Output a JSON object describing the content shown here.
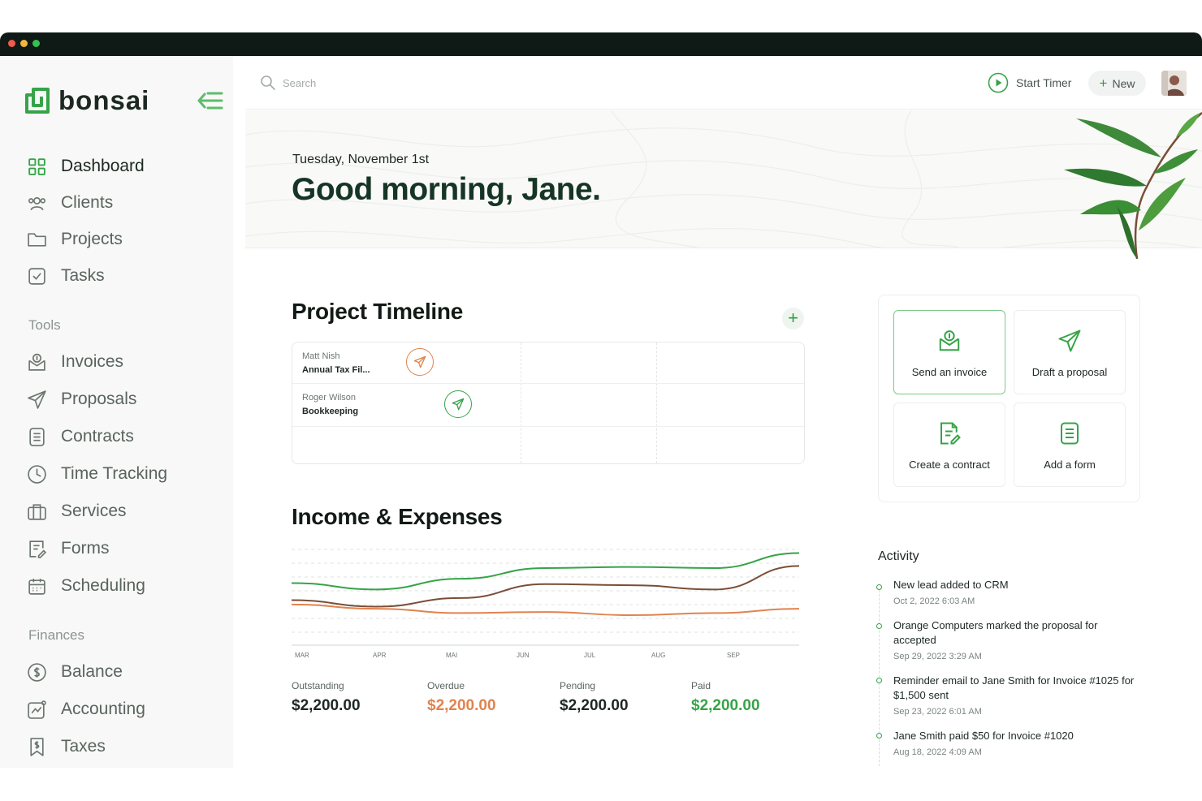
{
  "brand": {
    "name": "bonsai"
  },
  "nav": {
    "main": [
      {
        "label": "Dashboard",
        "icon": "dashboard-icon",
        "active": true
      },
      {
        "label": "Clients",
        "icon": "clients-icon"
      },
      {
        "label": "Projects",
        "icon": "folder-icon"
      },
      {
        "label": "Tasks",
        "icon": "checkbox-icon"
      }
    ],
    "tools_heading": "Tools",
    "tools": [
      {
        "label": "Invoices",
        "icon": "invoice-icon"
      },
      {
        "label": "Proposals",
        "icon": "paper-plane-icon"
      },
      {
        "label": "Contracts",
        "icon": "document-icon"
      },
      {
        "label": "Time Tracking",
        "icon": "clock-icon"
      },
      {
        "label": "Services",
        "icon": "briefcase-icon"
      },
      {
        "label": "Forms",
        "icon": "form-icon"
      },
      {
        "label": "Scheduling",
        "icon": "calendar-icon"
      }
    ],
    "finances_heading": "Finances",
    "finances": [
      {
        "label": "Balance",
        "icon": "dollar-circle-icon"
      },
      {
        "label": "Accounting",
        "icon": "chart-line-icon"
      },
      {
        "label": "Taxes",
        "icon": "receipt-icon"
      }
    ]
  },
  "topbar": {
    "search_placeholder": "Search",
    "start_timer": "Start Timer",
    "new_label": "New"
  },
  "hero": {
    "date": "Tuesday, November 1st",
    "greeting": "Good morning, Jane."
  },
  "timeline": {
    "title": "Project Timeline",
    "rows": [
      {
        "client": "Matt Nish",
        "project": "Annual Tax Fil...",
        "status_color": "#e0834f"
      },
      {
        "client": "Roger Wilson",
        "project": "Bookkeeping",
        "status_color": "#35a447"
      }
    ]
  },
  "income": {
    "title": "Income & Expenses",
    "stats": [
      {
        "label": "Outstanding",
        "value": "$2,200.00",
        "color": "#1d2822"
      },
      {
        "label": "Overdue",
        "value": "$2,200.00",
        "color": "#e0834f"
      },
      {
        "label": "Pending",
        "value": "$2,200.00",
        "color": "#1d2822"
      },
      {
        "label": "Paid",
        "value": "$2,200.00",
        "color": "#35a447"
      }
    ]
  },
  "chart_data": {
    "type": "line",
    "x": [
      "MAR",
      "APR",
      "MAI",
      "JUN",
      "JUL",
      "AUG",
      "SEP"
    ],
    "series": [
      {
        "color": "#35a447",
        "values": [
          58,
          52,
          62,
          72,
          73,
          72,
          86
        ]
      },
      {
        "color": "#7a4e36",
        "values": [
          42,
          36,
          44,
          57,
          56,
          52,
          74
        ]
      },
      {
        "color": "#e0834f",
        "values": [
          38,
          34,
          30,
          31,
          28,
          30,
          34
        ]
      }
    ],
    "ylim": [
      0,
      100
    ],
    "grid": true,
    "legend": "none"
  },
  "actions": [
    {
      "label": "Send an invoice",
      "icon": "invoice-send-icon",
      "primary": true
    },
    {
      "label": "Draft a proposal",
      "icon": "paper-plane-icon"
    },
    {
      "label": "Create a contract",
      "icon": "contract-icon"
    },
    {
      "label": "Add a form",
      "icon": "form-icon"
    }
  ],
  "activity": {
    "title": "Activity",
    "items": [
      {
        "text": "New lead added to CRM",
        "time": "Oct 2, 2022   6:03 AM"
      },
      {
        "text": "Orange Computers marked the proposal for accepted",
        "time": "Sep 29, 2022   3:29 AM"
      },
      {
        "text": "Reminder email to Jane Smith for Invoice #1025 for $1,500 sent",
        "time": "Sep 23, 2022   6:01 AM"
      },
      {
        "text": "Jane Smith paid $50 for Invoice #1020",
        "time": "Aug 18, 2022   4:09 AM"
      }
    ]
  },
  "colors": {
    "brand": "#35a447",
    "dark": "#163525",
    "orange": "#e0834f",
    "brown": "#7a4e36"
  }
}
